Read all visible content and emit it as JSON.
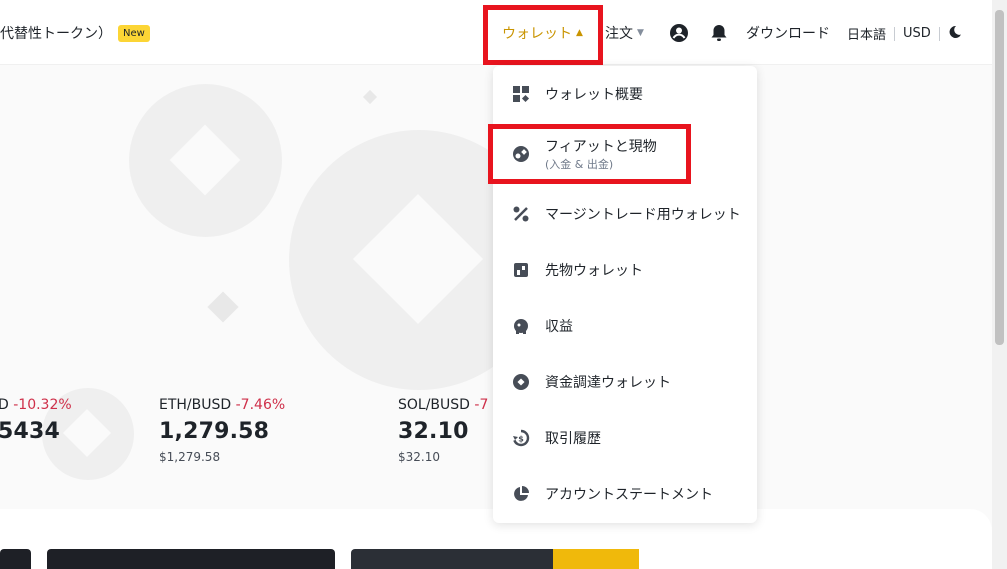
{
  "header": {
    "promo_text": "代替性トークン）",
    "promo_badge": "New",
    "wallet_label": "ウォレット",
    "orders_label": "注文",
    "download_label": "ダウンロード",
    "language_label": "日本語",
    "currency_label": "USD",
    "icons": [
      "account-icon",
      "bell-icon",
      "moon-icon"
    ]
  },
  "tickers": [
    {
      "pair_prefix": "D",
      "change": "-10.32%",
      "price": "5434",
      "sub": ""
    },
    {
      "pair_prefix": "ETH/BUSD",
      "change": "-7.46%",
      "price": "1,279.58",
      "sub": "$1,279.58"
    },
    {
      "pair_prefix": "SOL/BUSD",
      "change": "-7",
      "price": "32.10",
      "sub": "$32.10"
    }
  ],
  "wallet_menu": {
    "items": [
      {
        "label": "ウォレット概要",
        "icon": "grid-icon"
      },
      {
        "label": "フィアットと現物",
        "sublabel": "(入金 & 出金)",
        "icon": "fiat-spot-icon"
      },
      {
        "label": "マージントレード用ウォレット",
        "icon": "margin-percent-icon"
      },
      {
        "label": "先物ウォレット",
        "icon": "futures-icon"
      },
      {
        "label": "収益",
        "icon": "piggy-bank-icon"
      },
      {
        "label": "資金調達ウォレット",
        "icon": "funding-icon"
      },
      {
        "label": "取引履歴",
        "icon": "history-icon"
      },
      {
        "label": "アカウントステートメント",
        "icon": "pie-chart-icon"
      }
    ]
  },
  "colors": {
    "accent": "#c99400",
    "highlight": "#e8141e",
    "negative": "#cf304a",
    "badge": "#fcd535"
  }
}
